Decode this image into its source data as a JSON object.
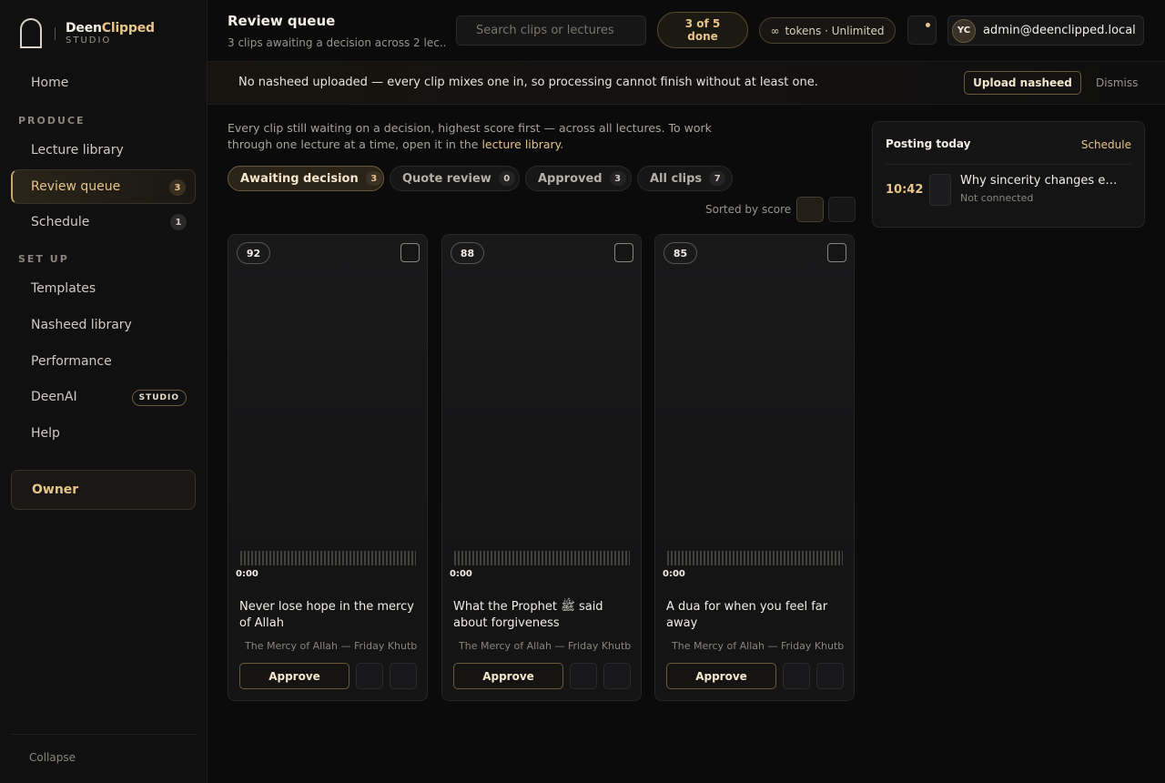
{
  "brand": {
    "name_part1": "Deen",
    "name_part2": "Clipped",
    "sub": "STUDIO"
  },
  "sidebar": {
    "items": [
      {
        "label": "Home"
      },
      {
        "label": "Lecture library"
      },
      {
        "label": "Review queue",
        "badge": "3"
      },
      {
        "label": "Schedule",
        "badge": "1"
      },
      {
        "label": "Templates"
      },
      {
        "label": "Nasheed library"
      },
      {
        "label": "Performance"
      },
      {
        "label": "DeenAI",
        "pill": "STUDIO"
      },
      {
        "label": "Help"
      }
    ],
    "sections": {
      "produce": "PRODUCE",
      "setup": "SET UP"
    },
    "owner": "Owner",
    "collapse": "Collapse"
  },
  "header": {
    "title": "Review queue",
    "subtitle": "3 clips awaiting a decision across 2 lec...",
    "search_placeholder": "Search clips or lectures",
    "progress_line1": "3 of 5",
    "progress_line2": "done",
    "tokens_symbol": "∞",
    "tokens_label": "tokens · Unlimited",
    "avatar_initials": "YC",
    "account_email": "admin@deenclipped.local"
  },
  "banner": {
    "message": "No nasheed uploaded — every clip mixes one in, so processing cannot finish without at least one.",
    "upload_label": "Upload nasheed",
    "dismiss_label": "Dismiss"
  },
  "main": {
    "intro_text": "Every clip still waiting on a decision, highest score first — across all lectures. To work through one lecture at a time, open it in the ",
    "intro_link": "lecture library",
    "intro_end": ".",
    "tabs": [
      {
        "label": "Awaiting decision",
        "count": "3"
      },
      {
        "label": "Quote review",
        "count": "0"
      },
      {
        "label": "Approved",
        "count": "3"
      },
      {
        "label": "All clips",
        "count": "7"
      }
    ],
    "sorted_label": "Sorted by score"
  },
  "clips": [
    {
      "score": "92",
      "time": "0:00",
      "title": "Never lose hope in the mercy of Allah",
      "source": "The Mercy of Allah — Friday Khutb",
      "approve": "Approve"
    },
    {
      "score": "88",
      "time": "0:00",
      "title": "What the Prophet ﷺ said about forgiveness",
      "source": "The Mercy of Allah — Friday Khutb",
      "approve": "Approve"
    },
    {
      "score": "85",
      "time": "0:00",
      "title": "A dua for when you feel far away",
      "source": "The Mercy of Allah — Friday Khutb",
      "approve": "Approve"
    }
  ],
  "posting": {
    "title": "Posting today",
    "link": "Schedule",
    "time": "10:42",
    "item_title": "Why sincerity changes eve...",
    "status": "Not connected"
  },
  "colors": {
    "accent": "#e6c48a",
    "background": "#0b0b0c",
    "panel": "#141415"
  }
}
